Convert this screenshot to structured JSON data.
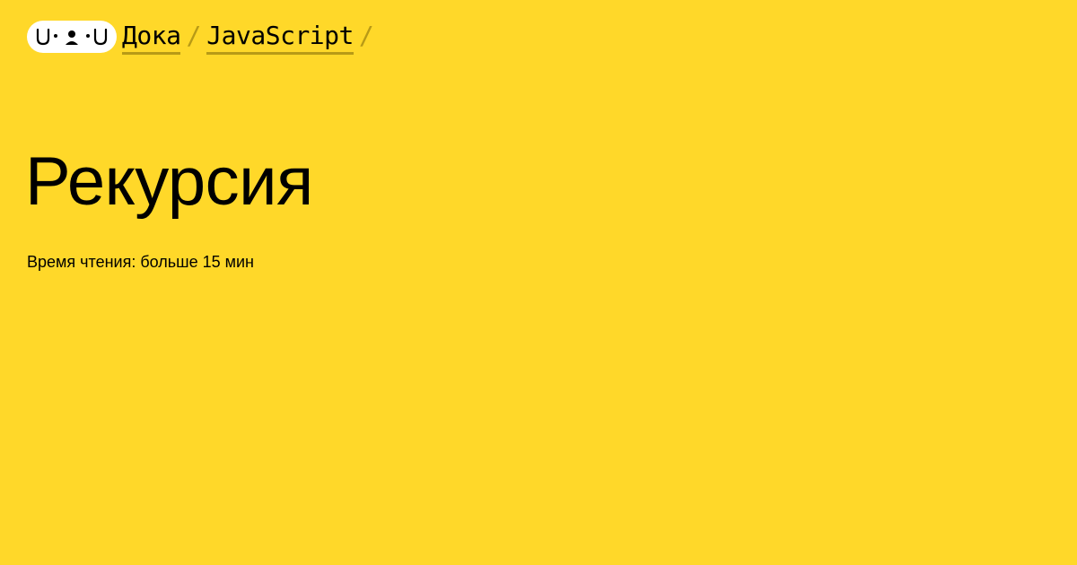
{
  "breadcrumb": {
    "logo_icon": "doka-logo-icon",
    "items": [
      {
        "label": "Дока"
      },
      {
        "label": "JavaScript"
      }
    ],
    "separator": "/"
  },
  "article": {
    "title": "Рекурсия",
    "reading_time": "Время чтения: больше 15 мин"
  },
  "colors": {
    "background": "#ffd829",
    "text": "#000000",
    "underline": "#b89a16",
    "logo_bg": "#ffffff"
  }
}
